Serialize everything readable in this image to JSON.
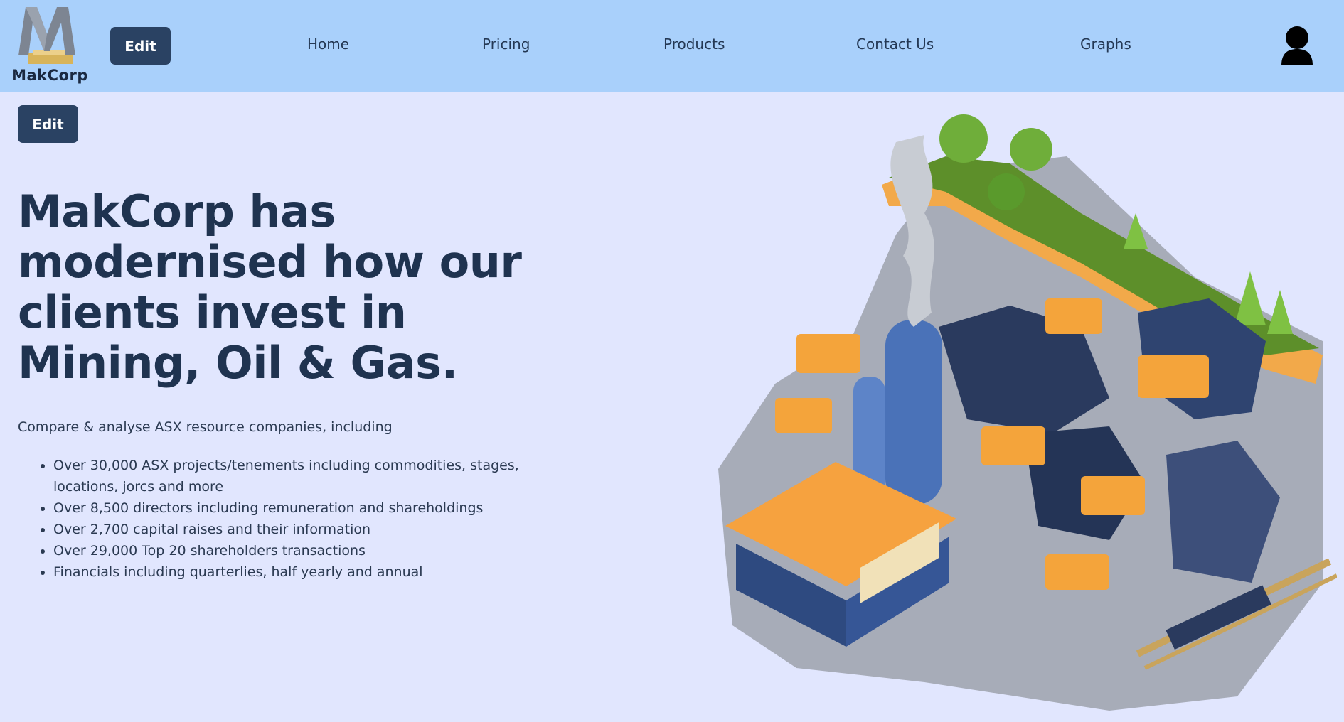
{
  "brand": {
    "name": "MakCorp"
  },
  "nav": {
    "edit_label": "Edit",
    "links": [
      "Home",
      "Pricing",
      "Products",
      "Contact Us",
      "Graphs"
    ]
  },
  "page": {
    "edit_label": "Edit",
    "title": "MakCorp has modernised how our clients invest in Mining, Oil & Gas.",
    "subtitle": "Compare & analyse ASX resource companies, including",
    "features": [
      "Over 30,000 ASX projects/tenements including commodities, stages, locations, jorcs and more",
      "Over 8,500 directors including remuneration and shareholdings",
      "Over 2,700 capital raises and their information",
      "Over 29,000 Top 20 shareholders transactions",
      "Financials including quarterlies, half yearly and annual"
    ]
  },
  "icons": {
    "profile": "user-avatar-icon",
    "logo": "makcorp-logo"
  },
  "colors": {
    "navbar_bg": "#a9d0fb",
    "page_bg": "#e1e6fe",
    "button_bg": "#2a4263",
    "heading": "#1f3350",
    "accent_orange": "#f6a23f",
    "accent_blue": "#4a72b8"
  }
}
